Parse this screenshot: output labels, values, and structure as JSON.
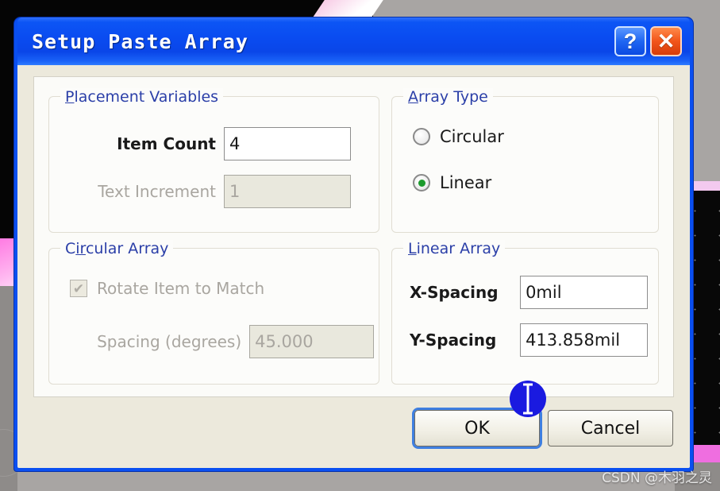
{
  "window": {
    "title": "Setup Paste Array",
    "help_button": "?",
    "close_button": "✕"
  },
  "groups": {
    "placement": {
      "title_mnemonic": "P",
      "title_rest": "lacement  Variables",
      "fields": [
        {
          "label": "Item Count",
          "value": "4",
          "enabled": true
        },
        {
          "label": "Text Increment",
          "value": "1",
          "enabled": false
        }
      ]
    },
    "array_type": {
      "title_mnemonic": "A",
      "title_rest": "rray Type",
      "options": [
        {
          "label": "Circular",
          "selected": false
        },
        {
          "label": "Linear",
          "selected": true
        }
      ]
    },
    "circular_array": {
      "title_mnemonic": "ir",
      "title_prefix": "C",
      "title_rest": "cular Array",
      "checkbox": {
        "label": "Rotate Item to Match",
        "checked": true,
        "enabled": false,
        "glyph": "✔"
      },
      "field": {
        "label": "Spacing (degrees)",
        "value": "45.000",
        "enabled": false
      }
    },
    "linear_array": {
      "title_mnemonic": "L",
      "title_rest": "inear Array",
      "fields": [
        {
          "label": "X-Spacing",
          "value": "0mil",
          "enabled": true
        },
        {
          "label": "Y-Spacing",
          "value": "413.858mil",
          "enabled": true
        }
      ]
    }
  },
  "buttons": {
    "ok": "OK",
    "cancel": "Cancel"
  },
  "watermark": "CSDN @木羽之灵",
  "colors": {
    "titlebar_blue": "#0a4bf0",
    "group_label_blue": "#2b3fa8",
    "radio_selected_green": "#1c9b2d",
    "close_button_orange": "#f2561b",
    "dialog_body_beige": "#ece9dc",
    "cursor_halo_blue": "#1a1ae0"
  }
}
